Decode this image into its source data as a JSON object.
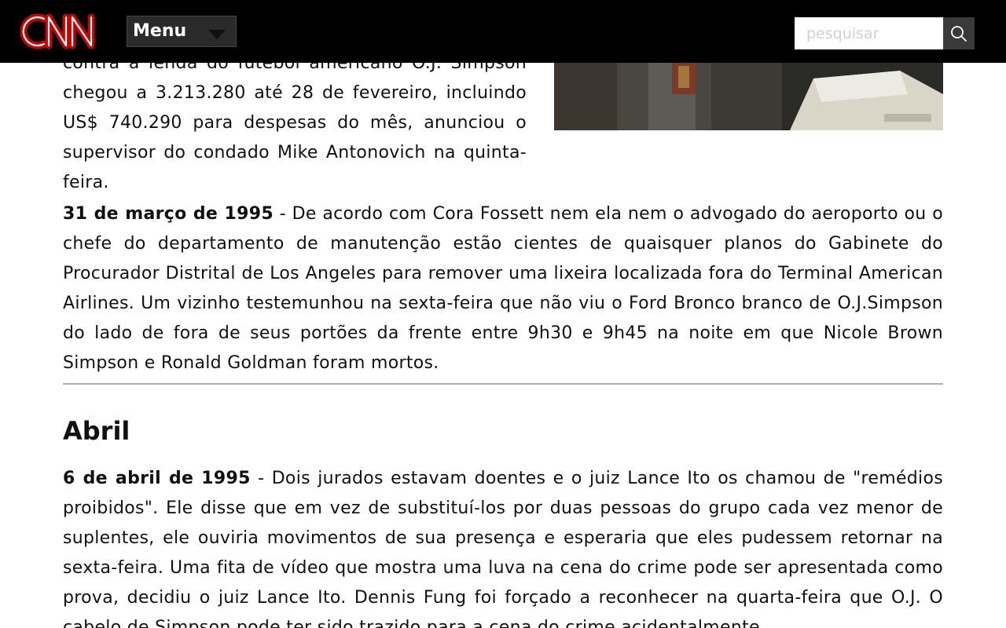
{
  "brand": {
    "logo_text": "CNN",
    "logo_color": "#cc0000",
    "bar_color": "#000000"
  },
  "nav": {
    "menu_label": "Menu",
    "menu_icon": "caret-down-icon",
    "search_placeholder": "pesquisar",
    "search_icon": "search-icon"
  },
  "article": {
    "intro_text": "contra a lenda do futebol americano O.J. Simpson chegou a 3.213.280 até 28 de fevereiro, incluindo US$ 740.290 para despesas do mês, anunciou o supervisor do condado Mike Antonovich na quinta-feira.",
    "entries": [
      {
        "date": "31 de março de 1995",
        "separator": " - ",
        "text": "De acordo com Cora Fossett nem ela nem o advogado do aeroporto ou o chefe do departamento de manutenção estão cientes de quaisquer planos do Gabinete do Procurador Distrital de Los Angeles para remover uma lixeira localizada fora do Terminal American Airlines. Um vizinho testemunhou na sexta-feira que não viu o Ford Bronco branco de O.J.Simpson do lado de fora de seus portões da frente entre 9h30 e 9h45 na noite em que Nicole Brown Simpson e Ronald Goldman foram mortos."
      }
    ],
    "section_heading": "Abril",
    "section_entries": [
      {
        "date": "6 de abril de 1995",
        "separator": " - ",
        "text": "Dois jurados estavam doentes e o juiz Lance Ito os chamou de \"remédios proibidos\". Ele disse que em vez de substituí-los por duas pessoas do grupo cada vez menor de suplentes, ele ouviria movimentos de sua presença e esperaria que eles pudessem retornar na sexta-feira. Uma fita de vídeo que mostra uma luva na cena do crime pode ser apresentada como prova, decidiu o juiz Lance Ito. Dennis Fung foi forçado a reconhecer na quarta-feira que O.J. O cabelo de Simpson pode ter sido trazido para a cena do crime acidentalmente."
      }
    ]
  }
}
